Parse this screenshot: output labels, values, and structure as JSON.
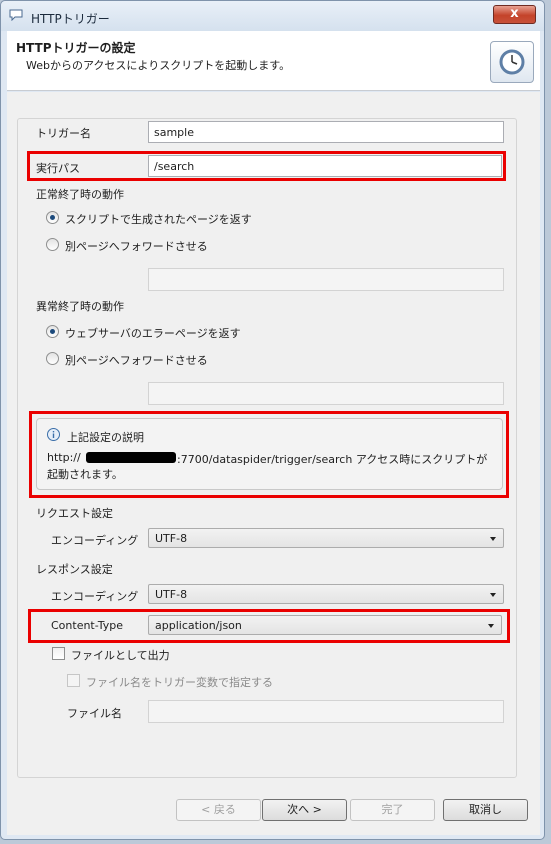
{
  "window": {
    "title": "HTTPトリガー",
    "close_label": "x"
  },
  "header": {
    "title": "HTTPトリガーの設定",
    "subtitle": "Webからのアクセスによりスクリプトを起動します。",
    "icon": "clock-icon"
  },
  "form": {
    "trigger_name": {
      "label": "トリガー名",
      "value": "sample"
    },
    "exec_path": {
      "label": "実行パス",
      "value": "/search"
    },
    "normal_end": {
      "label": "正常終了時の動作",
      "options": [
        "スクリプトで生成されたページを返す",
        "別ページへフォワードさせる"
      ],
      "selected": 0,
      "forward_value": ""
    },
    "abnormal_end": {
      "label": "異常終了時の動作",
      "options": [
        "ウェブサーバのエラーページを返す",
        "別ページへフォワードさせる"
      ],
      "selected": 0,
      "forward_value": ""
    },
    "info": {
      "title": "上記設定の説明",
      "line1_prefix": "http://",
      "line1_suffix": ":7700/dataspider/trigger/search アクセス時にスクリプトが",
      "line2": "起動されます。"
    },
    "request": {
      "label": "リクエスト設定",
      "encoding_label": "エンコーディング",
      "encoding_value": "UTF-8"
    },
    "response": {
      "label": "レスポンス設定",
      "encoding_label": "エンコーディング",
      "encoding_value": "UTF-8",
      "content_type_label": "Content-Type",
      "content_type_value": "application/json"
    },
    "file_output": {
      "label": "ファイルとして出力",
      "checked": false
    },
    "file_name_var": {
      "label": "ファイル名をトリガー変数で指定する",
      "checked": false,
      "disabled": true
    },
    "file_name": {
      "label": "ファイル名",
      "value": ""
    }
  },
  "buttons": {
    "back": "< 戻る",
    "next": "次へ >",
    "finish": "完了",
    "cancel": "取消し"
  },
  "colors": {
    "highlight": "#ea0000",
    "accent": "#1c4a7c"
  }
}
